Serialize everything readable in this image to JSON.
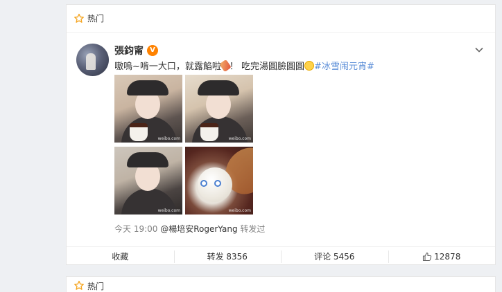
{
  "hot_label": "热门",
  "post": {
    "username": "張鈞甯",
    "verified_mark": "V",
    "text_main": "嗷嗚~啃一大口，就露餡啦",
    "text_mid": "！ 吃完湯圓臉圓圓",
    "hashtag": "#冰雪闹元宵#",
    "time": "今天 19:00",
    "repost_user": "@楊培安RogerYang",
    "repost_suffix": "转发过",
    "photo_watermark": "weibo.com"
  },
  "actions": {
    "favorite": "收藏",
    "repost": "转发 8356",
    "comment": "评论 5456",
    "like_count": "12878"
  },
  "second_card": {
    "hot_label": "热门"
  },
  "colors": {
    "hashtag": "#5d8fd8",
    "verified": "#ff8200",
    "hot_star": "#f5a623"
  }
}
